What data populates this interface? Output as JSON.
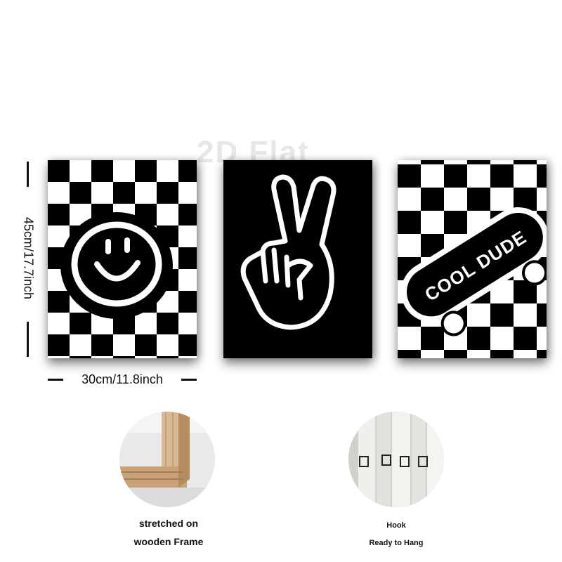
{
  "watermark": "2D Flat",
  "dimensions": {
    "height": "45cm/17.7inch",
    "width": "30cm/11.8inch"
  },
  "paintings": [
    {
      "name": "smiley-face",
      "background": "checkerboard"
    },
    {
      "name": "peace-hand",
      "background": "black"
    },
    {
      "name": "skateboard",
      "background": "checkerboard",
      "text": "COOL DUDE"
    }
  ],
  "details": [
    {
      "photo": "wooden-frame-corner",
      "caption_lines": [
        "stretched on",
        "wooden Frame"
      ]
    },
    {
      "photo": "hanging-hooks",
      "caption_lines": [
        "Hook",
        "Ready to Hang"
      ]
    }
  ],
  "colors": {
    "black": "#000000",
    "white": "#ffffff",
    "wood": "#d8b48a"
  }
}
